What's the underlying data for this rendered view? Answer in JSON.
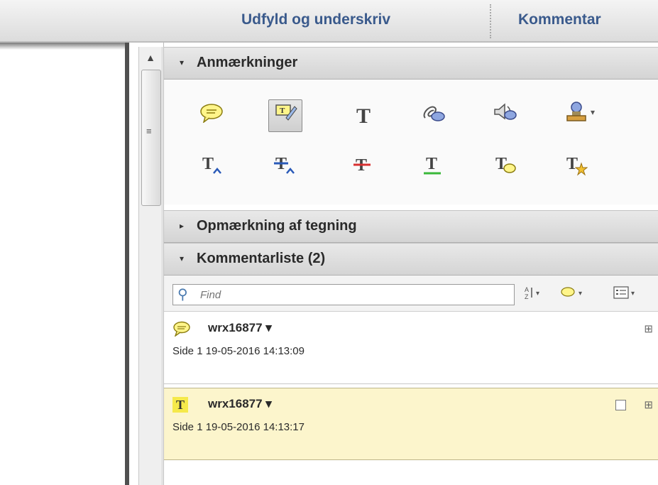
{
  "topbar": {
    "tab_fill_sign": "Udfyld og underskriv",
    "tab_comment": "Kommentar"
  },
  "sections": {
    "annotations": {
      "label": "Anmærkninger",
      "arrow": "▾"
    },
    "drawing_markup": {
      "label": "Opmærkning af tegning",
      "arrow": "▸"
    },
    "comment_list": {
      "label": "Kommentarliste (2)",
      "arrow": "▾"
    }
  },
  "tools": {
    "row1": [
      "sticky-note-icon",
      "highlight-text-icon",
      "add-text-icon",
      "attach-file-icon",
      "record-audio-icon",
      "stamp-icon"
    ],
    "row2": [
      "insert-text-icon",
      "replace-text-icon",
      "strikethrough-icon",
      "underline-icon",
      "text-note-icon",
      "text-star-icon"
    ]
  },
  "search": {
    "placeholder": "Find"
  },
  "comments": [
    {
      "author": "wrx16877 ▾",
      "meta": "Side 1  19-05-2016 14:13:09",
      "type": "sticky-note"
    },
    {
      "author": "wrx16877 ▾",
      "meta": "Side 1  19-05-2016 14:13:17",
      "type": "text-highlight",
      "type_glyph": "T"
    }
  ],
  "colors": {
    "tab_text": "#3a5a8c",
    "selected_comment_bg": "#fcf5cc",
    "highlight_yellow": "#f5e94a"
  }
}
